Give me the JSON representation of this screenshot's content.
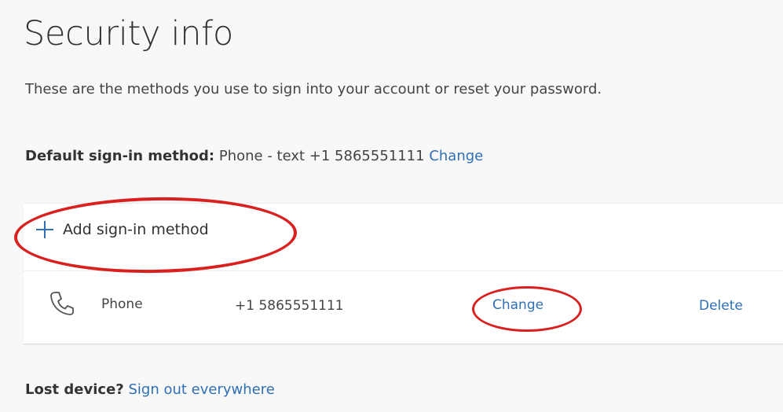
{
  "page": {
    "title": "Security info",
    "description": "These are the methods you use to sign into your account or reset your password."
  },
  "default_method": {
    "label": "Default sign-in method:",
    "value": "Phone - text +1 5865551111",
    "change_link": "Change"
  },
  "add_method": {
    "label": "Add sign-in method",
    "icon": "plus-icon"
  },
  "methods": [
    {
      "icon": "phone-icon",
      "name": "Phone",
      "value": "+1 5865551111",
      "change_label": "Change",
      "delete_label": "Delete"
    }
  ],
  "lost_device": {
    "label": "Lost device?",
    "link": "Sign out everywhere"
  },
  "colors": {
    "link": "#2f6fb5",
    "annotation": "#d9201f",
    "plus_icon": "#2f6fb5"
  }
}
